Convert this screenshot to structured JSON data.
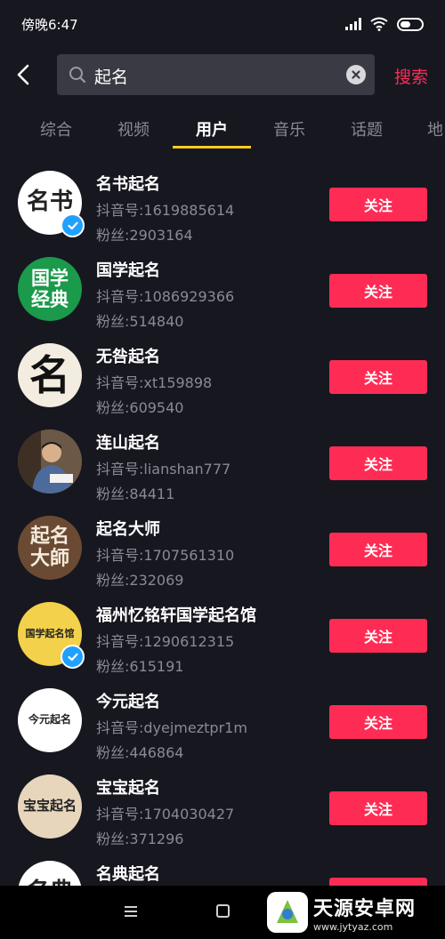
{
  "status": {
    "time": "傍晚6:47"
  },
  "search": {
    "query": "起名",
    "button_label": "搜索"
  },
  "tabs": [
    {
      "label": "综合"
    },
    {
      "label": "视频"
    },
    {
      "label": "用户"
    },
    {
      "label": "音乐"
    },
    {
      "label": "话题"
    },
    {
      "label": "地"
    }
  ],
  "active_tab": "用户",
  "users": [
    {
      "name": "名书起名",
      "id": "抖音号:1619885614",
      "fans": "粉丝:2903164",
      "follow": "关注",
      "avatar_text": "名书",
      "verified": true
    },
    {
      "name": "国学起名",
      "id": "抖音号:1086929366",
      "fans": "粉丝:514840",
      "follow": "关注",
      "avatar_text": "国学经典",
      "verified": false
    },
    {
      "name": "无咎起名",
      "id": "抖音号:xt159898",
      "fans": "粉丝:609540",
      "follow": "关注",
      "avatar_text": "名",
      "verified": false
    },
    {
      "name": "连山起名",
      "id": "抖音号:lianshan777",
      "fans": "粉丝:84411",
      "follow": "关注",
      "avatar_text": "",
      "verified": false
    },
    {
      "name": "起名大师",
      "id": "抖音号:1707561310",
      "fans": "粉丝:232069",
      "follow": "关注",
      "avatar_text": "起名大師",
      "verified": false
    },
    {
      "name": "福州忆铭轩国学起名馆",
      "id": "抖音号:1290612315",
      "fans": "粉丝:615191",
      "follow": "关注",
      "avatar_text": "国学起名馆",
      "verified": true
    },
    {
      "name": "今元起名",
      "id": "抖音号:dyejmeztpr1m",
      "fans": "粉丝:446864",
      "follow": "关注",
      "avatar_text": "今元起名",
      "verified": false
    },
    {
      "name": "宝宝起名",
      "id": "抖音号:1704030427",
      "fans": "粉丝:371296",
      "follow": "关注",
      "avatar_text": "宝宝起名",
      "verified": false
    },
    {
      "name": "名典起名",
      "id": "",
      "fans": "",
      "follow": "关注",
      "avatar_text": "名典",
      "verified": false
    }
  ],
  "watermark": {
    "title": "天源安卓网",
    "url": "www.jytyaz.com"
  },
  "colors": {
    "background": "#171720",
    "accent": "#fe2c55",
    "tab_indicator": "#facd1d",
    "verified": "#20a0ff"
  },
  "icons": {
    "back": "chevron-left-icon",
    "search": "search-icon",
    "clear": "clear-icon",
    "verified": "verified-check-icon",
    "menu": "menu-icon",
    "home": "home-square-icon"
  }
}
